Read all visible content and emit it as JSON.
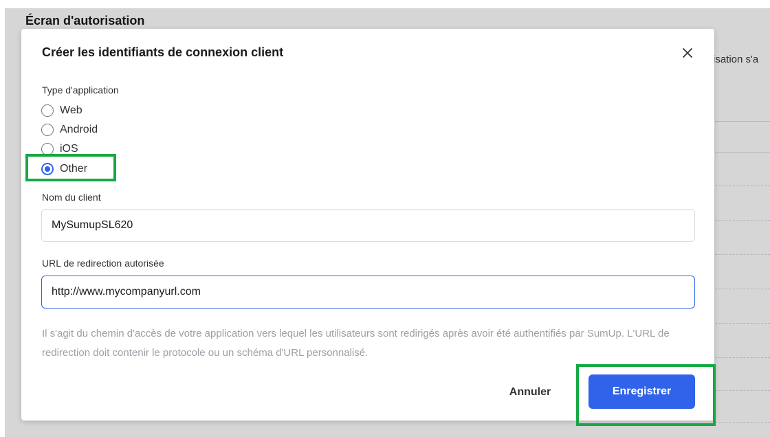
{
  "background": {
    "page_title": "Écran d'autorisation",
    "partial_text": "risation s'a"
  },
  "dialog": {
    "title": "Créer les identifiants de connexion client",
    "close_icon": "close-icon",
    "app_type": {
      "label": "Type d'application",
      "options": [
        "Web",
        "Android",
        "iOS",
        "Other"
      ],
      "selected": "Other"
    },
    "client_name": {
      "label": "Nom du client",
      "value": "MySumupSL620"
    },
    "redirect_url": {
      "label": "URL de redirection autorisée",
      "value": "http://www.mycompanyurl.com"
    },
    "help_text": "Il s'agit du chemin d'accès de votre application vers lequel les utilisateurs sont redirigés après avoir été authentifiés par SumUp. L'URL de redirection doit contenir le protocole ou un schéma d'URL personnalisé.",
    "cancel_label": "Annuler",
    "save_label": "Enregistrer"
  },
  "colors": {
    "primary": "#3063e9",
    "highlight": "#17a844",
    "overlay": "rgba(0,0,0,0.16)"
  }
}
